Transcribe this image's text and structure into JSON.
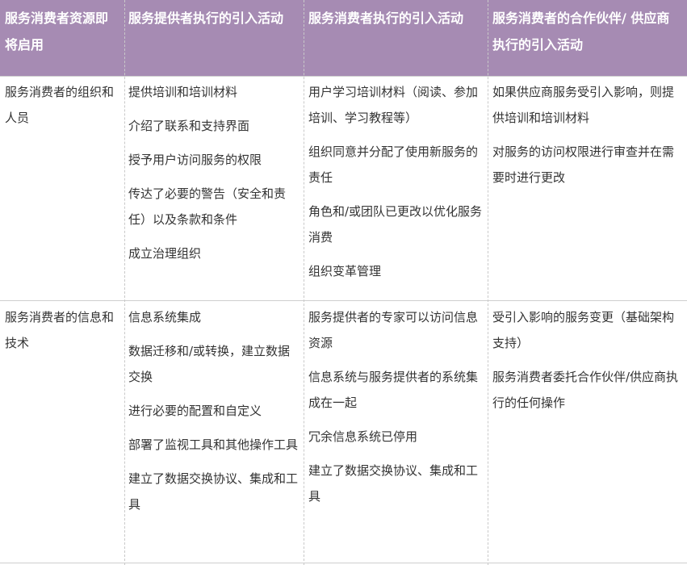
{
  "header": [
    "服务消费者资源即将启用",
    "服务提供者执行的引入活动",
    "服务消费者执行的引入活动",
    "服务消费者的合作伙伴/ 供应商执行的引入活动"
  ],
  "rows": [
    {
      "label": "服务消费者的组织和人员",
      "cols": [
        [
          "提供培训和培训材料",
          "介绍了联系和支持界面",
          "授予用户访问服务的权限",
          "传达了必要的警告（安全和责任）以及条款和条件",
          "成立治理组织"
        ],
        [
          "用户学习培训材料（阅读、参加培训、学习教程等）",
          "组织同意并分配了使用新服务的责任",
          "角色和/或团队已更改以优化服务消费",
          "组织变革管理"
        ],
        [
          "如果供应商服务受引入影响，则提供培训和培训材料",
          "对服务的访问权限进行审查并在需要时进行更改"
        ]
      ]
    },
    {
      "label": "服务消费者的信息和技术",
      "cols": [
        [
          "信息系统集成",
          "数据迁移和/或转换，建立数据交换",
          "进行必要的配置和自定义",
          "部署了监视工具和其他操作工具",
          "建立了数据交换协议、集成和工具"
        ],
        [
          "服务提供者的专家可以访问信息资源",
          "信息系统与服务提供者的系统集成在一起",
          "冗余信息系统已停用",
          "建立了数据交换协议、集成和工具"
        ],
        [
          "受引入影响的服务变更（基础架构支持）",
          "服务消费者委托合作伙伴/供应商执行的任何操作"
        ]
      ]
    }
  ]
}
